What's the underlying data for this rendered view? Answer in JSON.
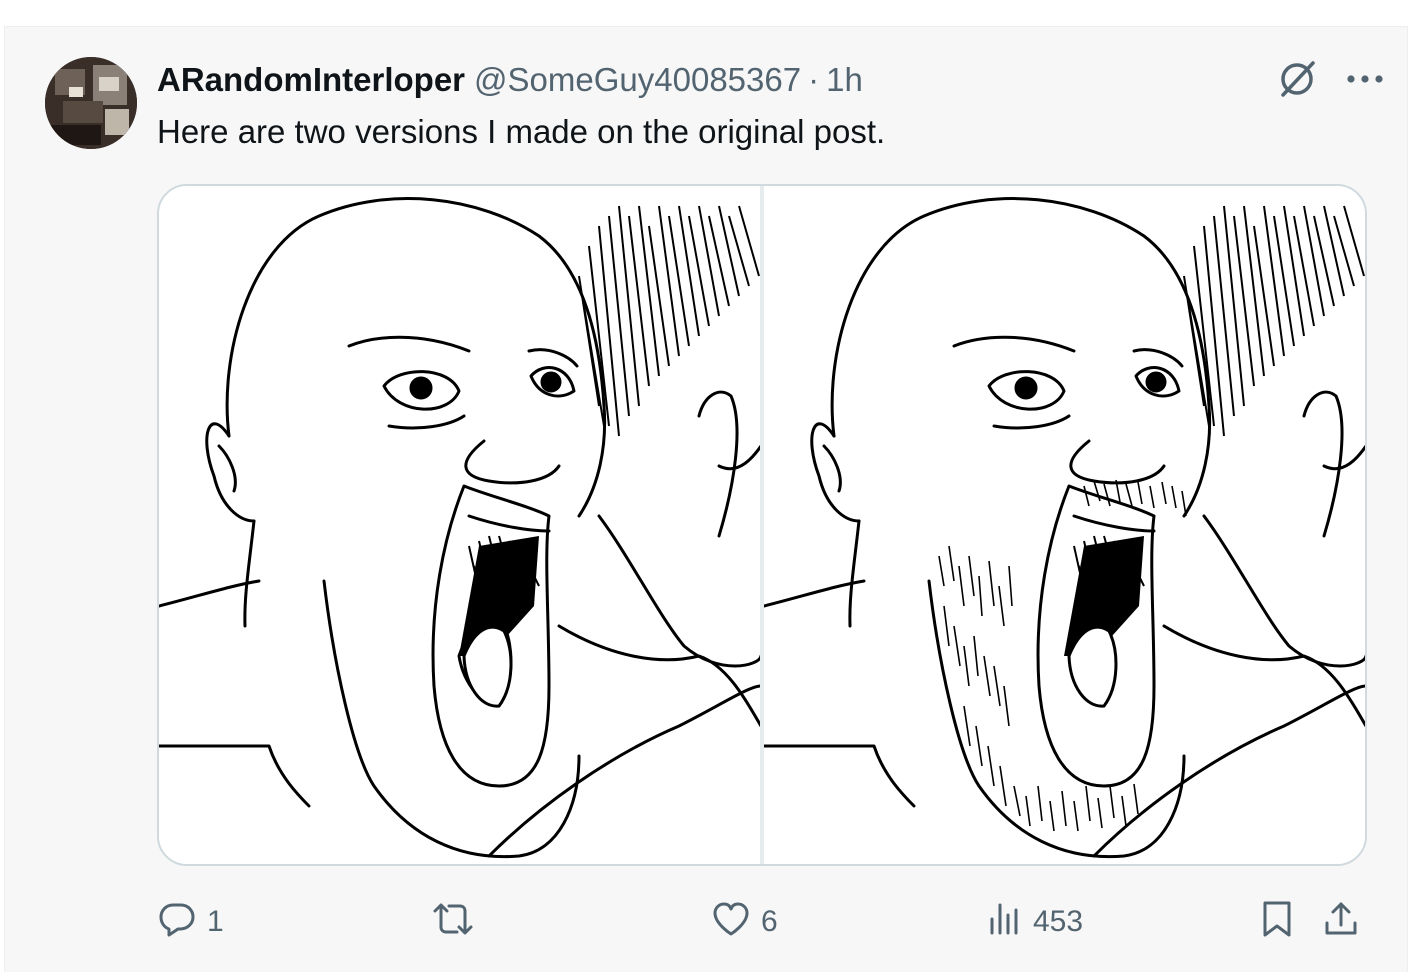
{
  "tweet": {
    "author": {
      "display_name": "ARandomInterloper",
      "handle": "@SomeGuy40085367",
      "separator": "·",
      "time": "1h",
      "avatar_icon": "avatar-photo"
    },
    "text": "Here are two versions I made on the original post.",
    "top_actions": {
      "grok_icon": "slashed-circle-icon",
      "more_icon": "more-dots-icon"
    },
    "media": [
      {
        "description_icon": "meme-drawing-clean-shaven"
      },
      {
        "description_icon": "meme-drawing-bearded"
      }
    ],
    "actions": {
      "replies": "1",
      "reposts": "",
      "likes": "6",
      "views": "453"
    },
    "colors": {
      "text_primary": "#0f1419",
      "text_secondary": "#536471",
      "background": "#f7f7f7",
      "border": "#cfd9de"
    }
  }
}
